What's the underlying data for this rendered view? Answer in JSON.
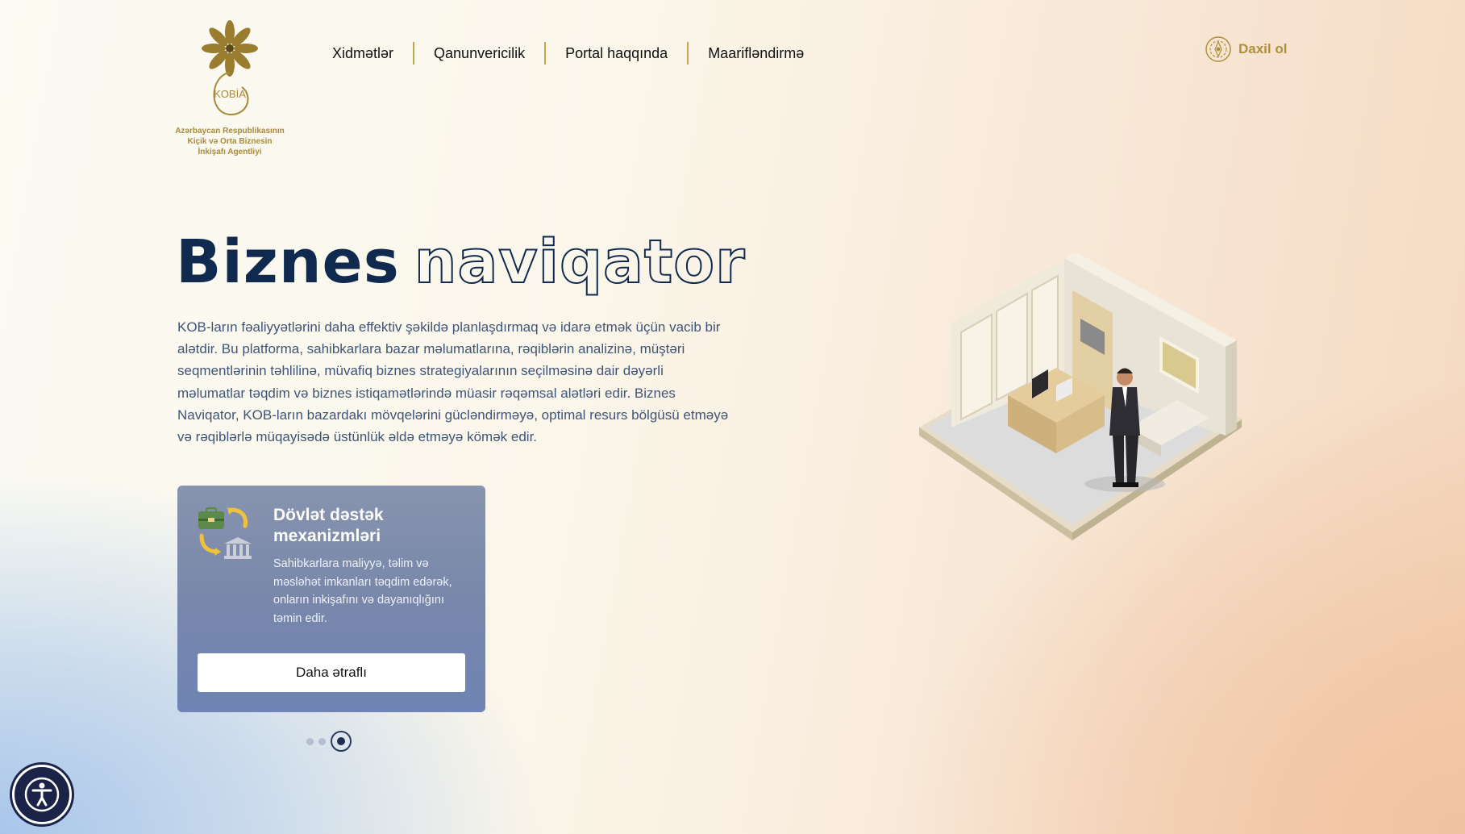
{
  "logo": {
    "text": "KOBİA",
    "subtitle_lines": [
      "Azərbaycan Respublikasının",
      "Kiçik və Orta Biznesin",
      "İnkişafı Agentliyi"
    ],
    "icon": "flower-emblem"
  },
  "nav": {
    "items": [
      {
        "label": "Xidmətlər"
      },
      {
        "label": "Qanunvericilik"
      },
      {
        "label": "Portal haqqında"
      },
      {
        "label": "Maarifləndirmə"
      }
    ]
  },
  "login": {
    "label": "Daxil ol",
    "icon": "emblem-icon"
  },
  "hero": {
    "title_solid": "Biznes",
    "title_outline": "naviqator",
    "description": "KOB-ların fəaliyyətlərini daha effektiv şəkildə planlaşdırmaq və idarə etmək üçün vacib bir alətdir. Bu platforma, sahibkarlara bazar məlumatlarına, rəqiblərin analizinə, müştəri seqmentlərinin təhlilinə, müvafiq biznes strategiyalarının seçilməsinə dair dəyərli məlumatlar təqdim və biznes istiqamətlərində müasir rəqəmsal alətləri edir. Biznes Naviqator, KOB-ların bazardakı mövqelərini gücləndirməyə, optimal resurs bölgüsü etməyə və rəqiblərlə müqayisədə üstünlük əldə etməyə kömək edir."
  },
  "card": {
    "icon": "briefcase-bank-exchange-icon",
    "title": "Dövlət dəstək mexanizmləri",
    "text": "Sahibkarlara maliyyə, təlim və məsləhət imkanları təqdim edərək, onların inkişafını və dayanıqlığını təmin edir.",
    "button": "Daha ətraflı"
  },
  "carousel": {
    "count": 3,
    "active": 3
  },
  "accessibility": {
    "icon": "accessibility-icon"
  },
  "colors": {
    "brand_gold": "#b08f3c",
    "navy": "#102a4f",
    "card": "#7887ab"
  }
}
